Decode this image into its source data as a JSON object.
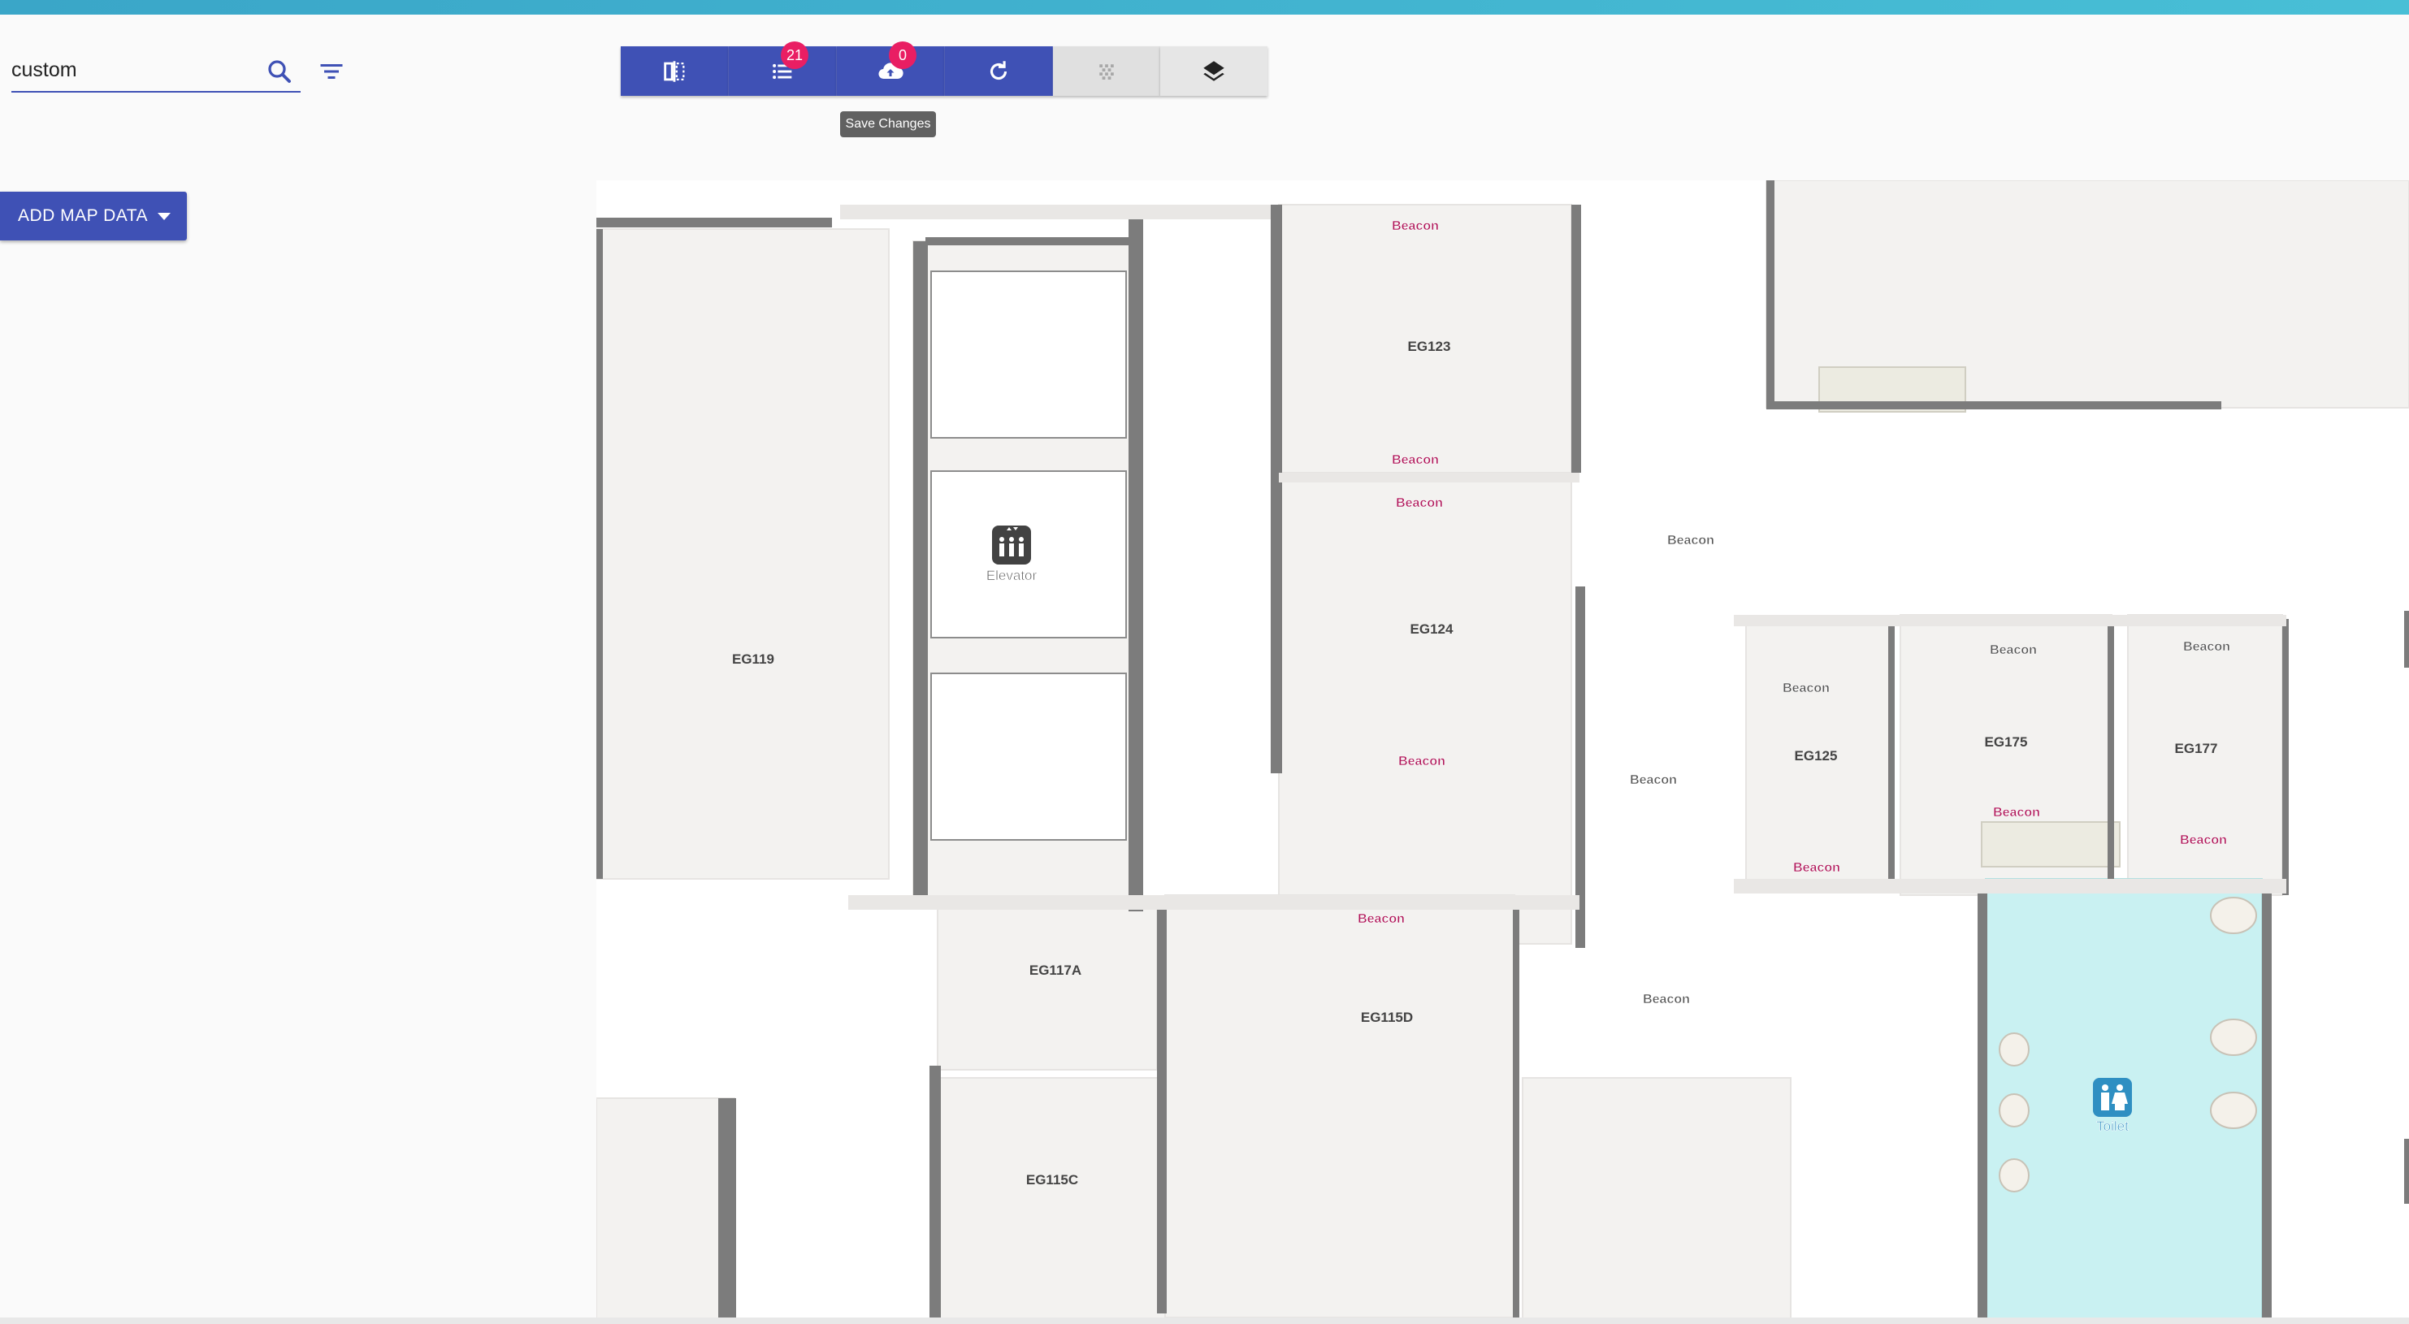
{
  "search": {
    "value": "custom"
  },
  "toolbar": {
    "list_badge": "21",
    "upload_badge": "0",
    "tooltip": "Save Changes"
  },
  "add_map_data": {
    "label": "ADD MAP DATA"
  },
  "icons": [
    "search-icon",
    "filter-icon",
    "split-view-icon",
    "list-icon",
    "cloud-upload-icon",
    "refresh-icon",
    "grid-dots-icon",
    "layers-icon",
    "elevator-icon",
    "toilet-icon"
  ],
  "colors": {
    "primary": "#3f51b5",
    "badge": "#e91e63",
    "toilet_fill": "#c9f1f2",
    "beacon_text": "#b0185a"
  },
  "map": {
    "rooms": [
      "EG119",
      "EG123",
      "EG124",
      "EG117A",
      "EG115D",
      "EG115C",
      "EG125",
      "EG175",
      "EG177"
    ],
    "pois": {
      "elevator": "Elevator",
      "toilet": "Toilet"
    },
    "beacon_label": "Beacon"
  }
}
